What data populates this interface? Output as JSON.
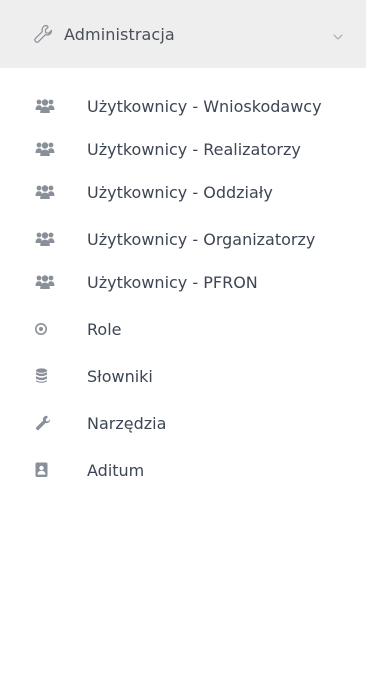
{
  "menu": {
    "header": {
      "label": "Administracja",
      "icon": "wrench-outline-icon",
      "toggle_icon": "chevron-down-icon"
    },
    "items": [
      {
        "label": "Użytkownicy - Wnioskodawcy",
        "icon": "users-icon"
      },
      {
        "label": "Użytkownicy - Realizatorzy",
        "icon": "users-icon"
      },
      {
        "label": "Użytkownicy - Oddziały",
        "icon": "users-icon"
      },
      {
        "label": "Użytkownicy - Organizatorzy",
        "icon": "users-icon"
      },
      {
        "label": "Użytkownicy - PFRON",
        "icon": "users-icon"
      },
      {
        "label": "Role",
        "icon": "dot-circle-icon"
      },
      {
        "label": "Słowniki",
        "icon": "database-icon"
      },
      {
        "label": "Narzędzia",
        "icon": "wrench-icon"
      },
      {
        "label": "Aditum",
        "icon": "id-badge-icon"
      }
    ]
  },
  "colors": {
    "header_bg": "#eeeeee",
    "icon_gray": "#8a9099",
    "text": "#3d4654"
  }
}
